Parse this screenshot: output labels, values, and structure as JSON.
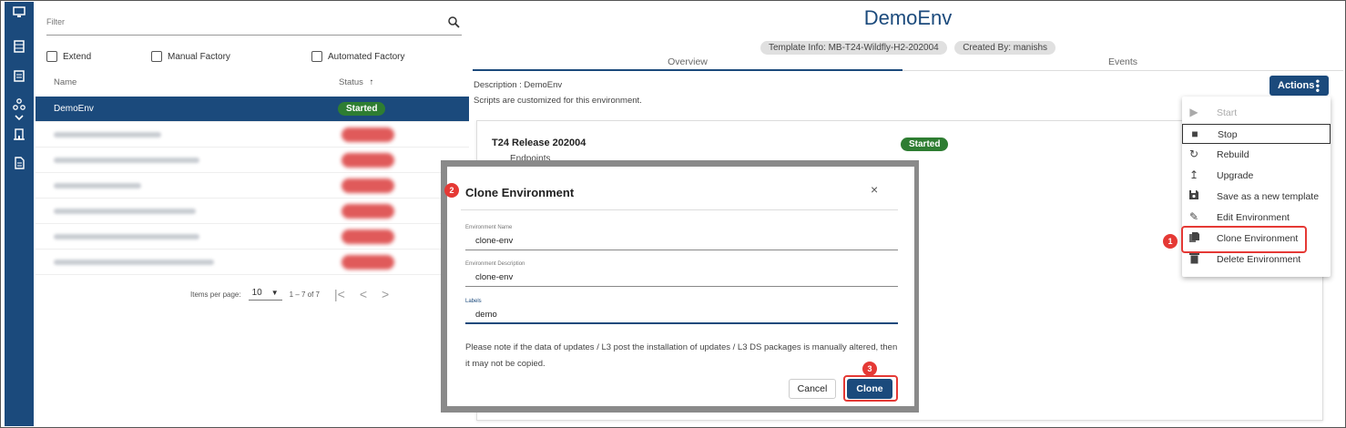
{
  "rail": {
    "icons": [
      "monitor-icon",
      "server-icon",
      "clipboard-icon",
      "hierarchy-icon",
      "chevron-down-icon",
      "building-icon",
      "document-icon"
    ]
  },
  "left": {
    "filter_placeholder": "Filter",
    "checkboxes": [
      "Extend",
      "Manual Factory",
      "Automated Factory"
    ],
    "columns": {
      "name": "Name",
      "status": "Status",
      "sort_arrow": "↑"
    },
    "rows": [
      {
        "name": "DemoEnv",
        "status": "Started",
        "selected": true
      }
    ],
    "pager": {
      "label": "Items per page:",
      "per_page": "10",
      "range": "1 – 7 of 7"
    }
  },
  "right": {
    "title": "DemoEnv",
    "chips": [
      "Template Info: MB-T24-Wildfly-H2-202004",
      "Created By: manishs"
    ],
    "tabs": [
      "Overview",
      "Events"
    ],
    "description": "Description : DemoEnv",
    "scripts_note": "Scripts are customized for this environment.",
    "actions_label": "Actions",
    "card": {
      "release": "T24 Release 202004",
      "status": "Started",
      "endpoints": "Endpoints"
    }
  },
  "menu": {
    "items": [
      {
        "label": "Start",
        "icon": "play-icon",
        "glyph": "▶"
      },
      {
        "label": "Stop",
        "icon": "stop-icon",
        "glyph": "■"
      },
      {
        "label": "Rebuild",
        "icon": "sync-icon",
        "glyph": "↻"
      },
      {
        "label": "Upgrade",
        "icon": "upload-icon",
        "glyph": "↥"
      },
      {
        "label": "Save as a new template",
        "icon": "save-icon",
        "glyph": "💾"
      },
      {
        "label": "Edit Environment",
        "icon": "pencil-icon",
        "glyph": "✎"
      },
      {
        "label": "Clone Environment",
        "icon": "copy-icon",
        "glyph": "❐"
      },
      {
        "label": "Delete Environment",
        "icon": "trash-icon",
        "glyph": "🗑"
      }
    ]
  },
  "dialog": {
    "title": "Clone Environment",
    "close": "×",
    "fields": [
      {
        "label": "Environment Name",
        "value": "clone-env"
      },
      {
        "label": "Environment Description",
        "value": "clone-env"
      },
      {
        "label": "Labels",
        "value": "demo"
      }
    ],
    "note": "Please note if the data of updates / L3 post the installation of updates / L3 DS packages is manually altered, then it may not be copied.",
    "cancel": "Cancel",
    "clone": "Clone"
  },
  "steps": [
    "1",
    "2",
    "3"
  ],
  "colors": {
    "primary": "#1b4a7c",
    "success": "#2e7d32",
    "highlight": "#e53935"
  }
}
